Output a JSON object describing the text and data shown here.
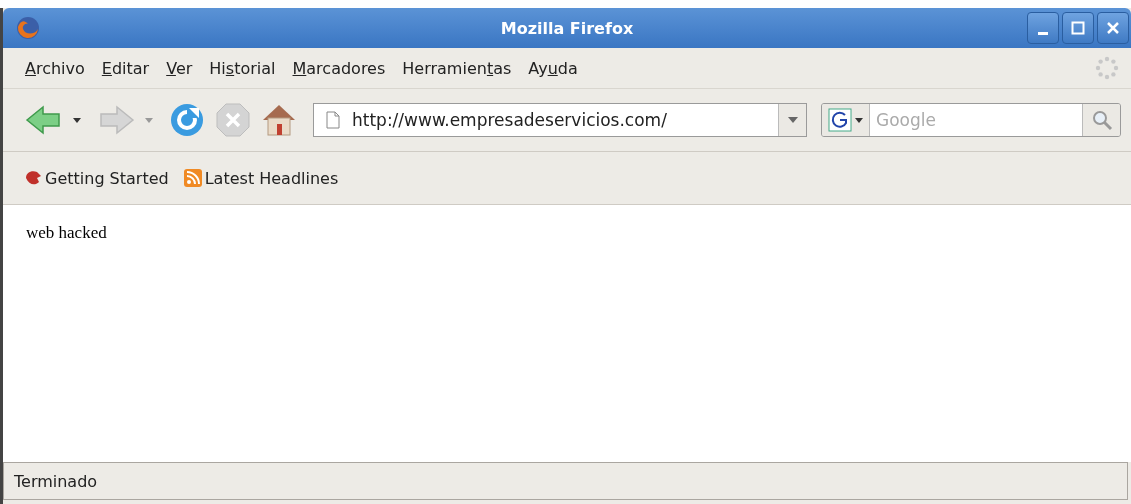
{
  "window": {
    "title": "Mozilla Firefox"
  },
  "menu": [
    {
      "key": "A",
      "post": "rchivo"
    },
    {
      "key": "E",
      "post": "ditar"
    },
    {
      "key": "V",
      "post": "er"
    },
    {
      "pre": "Hi",
      "key": "s",
      "post": "torial"
    },
    {
      "key": "M",
      "post": "arcadores"
    },
    {
      "pre": "Herramien",
      "key": "t",
      "post": "as"
    },
    {
      "pre": "Ay",
      "key": "u",
      "post": "da"
    }
  ],
  "toolbar": [
    {
      "kind": "back",
      "disabled": false
    },
    {
      "kind": "forward",
      "disabled": true
    },
    {
      "kind": "reload",
      "disabled": false
    },
    {
      "kind": "stop",
      "disabled": true
    },
    {
      "kind": "home",
      "disabled": false
    }
  ],
  "address": {
    "value": "http://www.empresadeservicios.com/"
  },
  "search": {
    "placeholder": "Google"
  },
  "bookmarks": [
    {
      "kind": "firefox",
      "label": "Getting Started"
    },
    {
      "kind": "feed",
      "label": "Latest Headlines"
    }
  ],
  "page": {
    "text": "web hacked"
  },
  "status_bar": {
    "text": "Terminado"
  }
}
